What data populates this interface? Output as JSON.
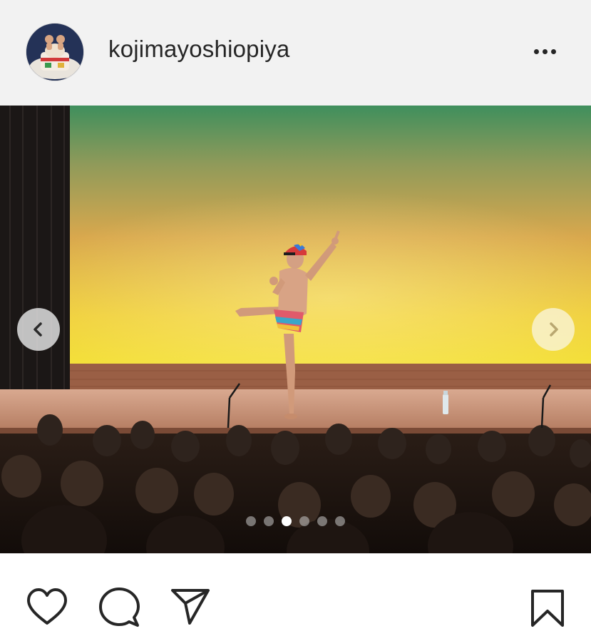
{
  "post": {
    "username": "kojimayoshiopiya"
  },
  "carousel": {
    "total": 6,
    "active_index": 2
  },
  "icons": {
    "more": "more-horizontal-icon",
    "prev": "chevron-left-icon",
    "next": "chevron-right-icon",
    "like": "heart-icon",
    "comment": "comment-bubble-icon",
    "share": "paper-plane-icon",
    "save": "bookmark-icon"
  },
  "colors": {
    "header_bg": "#f2f2f2",
    "text": "#262626",
    "icon": "#262626",
    "dot_active": "#ffffff",
    "dot_inactive": "#c8c8c8"
  }
}
